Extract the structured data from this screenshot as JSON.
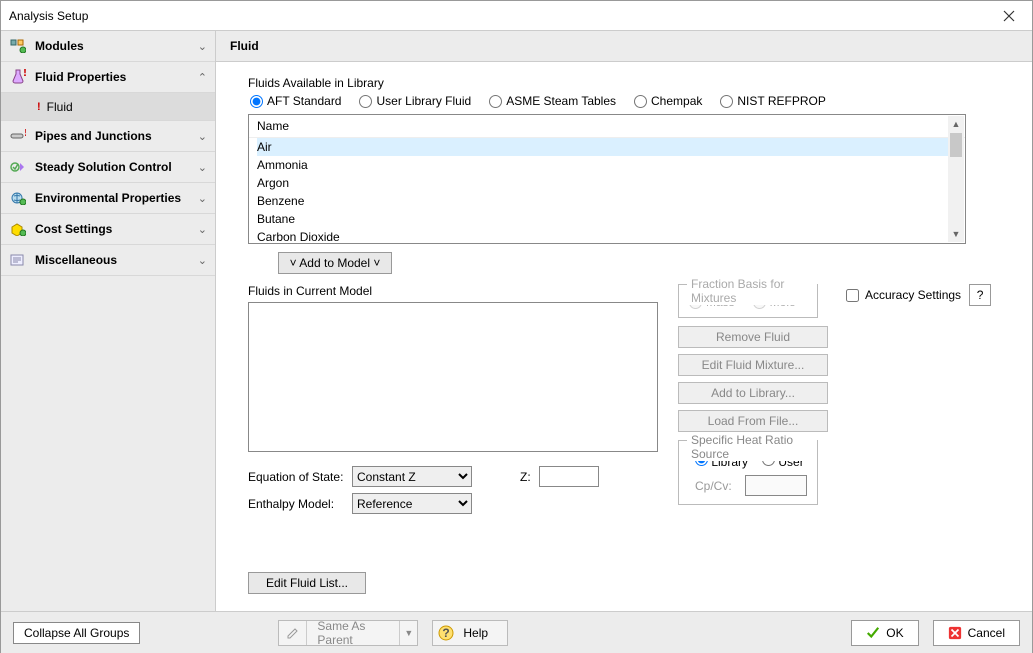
{
  "title": "Analysis Setup",
  "sidebar": {
    "groups": [
      {
        "label": "Modules",
        "expanded": false
      },
      {
        "label": "Fluid Properties",
        "expanded": true,
        "alert": true,
        "sub": {
          "label": "Fluid"
        }
      },
      {
        "label": "Pipes and Junctions",
        "expanded": false,
        "alert": true
      },
      {
        "label": "Steady Solution Control",
        "expanded": false
      },
      {
        "label": "Environmental Properties",
        "expanded": false
      },
      {
        "label": "Cost Settings",
        "expanded": false
      },
      {
        "label": "Miscellaneous",
        "expanded": false
      }
    ]
  },
  "main": {
    "heading": "Fluid",
    "library_label": "Fluids Available in Library",
    "radios": [
      "AFT Standard",
      "User Library Fluid",
      "ASME Steam Tables",
      "Chempak",
      "NIST REFPROP"
    ],
    "list_header": "Name",
    "fluids": [
      "Air",
      "Ammonia",
      "Argon",
      "Benzene",
      "Butane",
      "Carbon Dioxide"
    ],
    "add_to_model": "˅  Add to Model  ˅",
    "current_label": "Fluids in Current Model",
    "fraction": {
      "legend": "Fraction Basis for Mixtures",
      "mass": "Mass",
      "mole": "Mole"
    },
    "accuracy": "Accuracy Settings",
    "help_q": "?",
    "right_buttons": [
      "Remove Fluid",
      "Edit Fluid Mixture...",
      "Add to Library...",
      "Load From File..."
    ],
    "shrs": {
      "legend": "Specific Heat Ratio Source",
      "library": "Library",
      "user": "User",
      "cpcv": "Cp/Cv:"
    },
    "eq_state_label": "Equation of State:",
    "eq_state_value": "Constant Z",
    "z_label": "Z:",
    "enthalpy_label": "Enthalpy Model:",
    "enthalpy_value": "Reference",
    "edit_list": "Edit Fluid List..."
  },
  "footer": {
    "collapse": "Collapse All Groups",
    "same": "Same As Parent",
    "help": "Help",
    "ok": "OK",
    "cancel": "Cancel"
  }
}
